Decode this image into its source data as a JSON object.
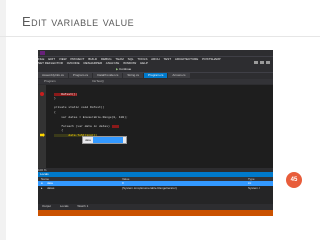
{
  "slide": {
    "title": "Edit variable value",
    "page_number": "45",
    "accent_color": "#e85d3b"
  },
  "vs": {
    "menu": [
      "FILE",
      "EDIT",
      "VIEW",
      "PROJECT",
      "BUILD",
      "DEBUG",
      "TEAM",
      "SQL",
      "TOOLS",
      "ARCH",
      "TEST",
      "ARCHITECTURE",
      "POSTSHARP",
      "NET REFLECTOR",
      "OZCODE",
      "RESHARPER",
      "ANALYZE",
      "WINDOW",
      "HELP"
    ],
    "continue_label": "Continue",
    "tabs": [
      "AssemblyInfo.cs",
      "Program.cs",
      "DataProvider.cs",
      "String.cs",
      "Program.cs",
      "Arrows.cs"
    ],
    "crumbs": [
      "Program",
      "DoTest()"
    ],
    "code": {
      "line1": "    DoTest();",
      "line2": "}",
      "line3": "private static void DoTest()",
      "line4": "{",
      "line5": "    var datas = Enumerable.Range(0, 100);",
      "line6": "    foreach (var data in datas)",
      "line7": "    {",
      "line8": "        data.ToString();"
    },
    "tooltip": {
      "name": "data",
      "value": "0"
    },
    "zoom": "100 %",
    "locals": {
      "title": "Locals",
      "columns": {
        "name": "Name",
        "value": "Value",
        "type": "Type"
      },
      "rows": [
        {
          "name": "data",
          "value": "0",
          "type": "int"
        },
        {
          "name": "datas",
          "value": "{System.Linq.Enumerable.RangeIterator}",
          "type": "System.I"
        }
      ]
    },
    "bottom_tabs": [
      "Output",
      "Locals",
      "Watch 1"
    ],
    "bottom_tabs2": [
      "Breakpoints",
      "Call Stack",
      "Immediate Window"
    ],
    "status_color": "#ca5100"
  }
}
